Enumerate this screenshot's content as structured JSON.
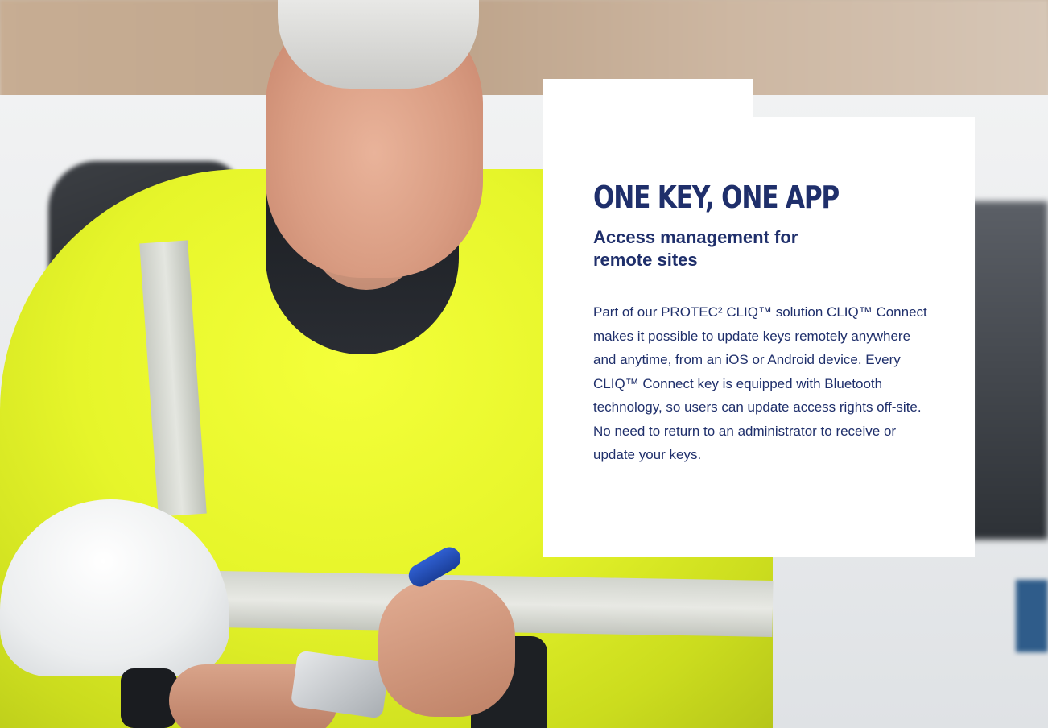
{
  "hero": {
    "image_alt": "Worker in high-visibility jacket using a phone and CLIQ key",
    "card": {
      "title": "ONE KEY, ONE APP",
      "subtitle": "Access management for remote sites",
      "body": "Part of our PROTEC² CLIQ™ solution CLIQ™ Connect makes it possible to update keys remotely anywhere and anytime, from an iOS or Android device. Every CLIQ™ Connect key is equipped with Bluetooth technology, so users can update access rights off-site. No need to return to an administrator to receive or update your keys."
    }
  },
  "colors": {
    "brand_navy": "#1f2f6b",
    "card_background": "#ffffff",
    "jacket_yellow": "#e6f52a"
  }
}
